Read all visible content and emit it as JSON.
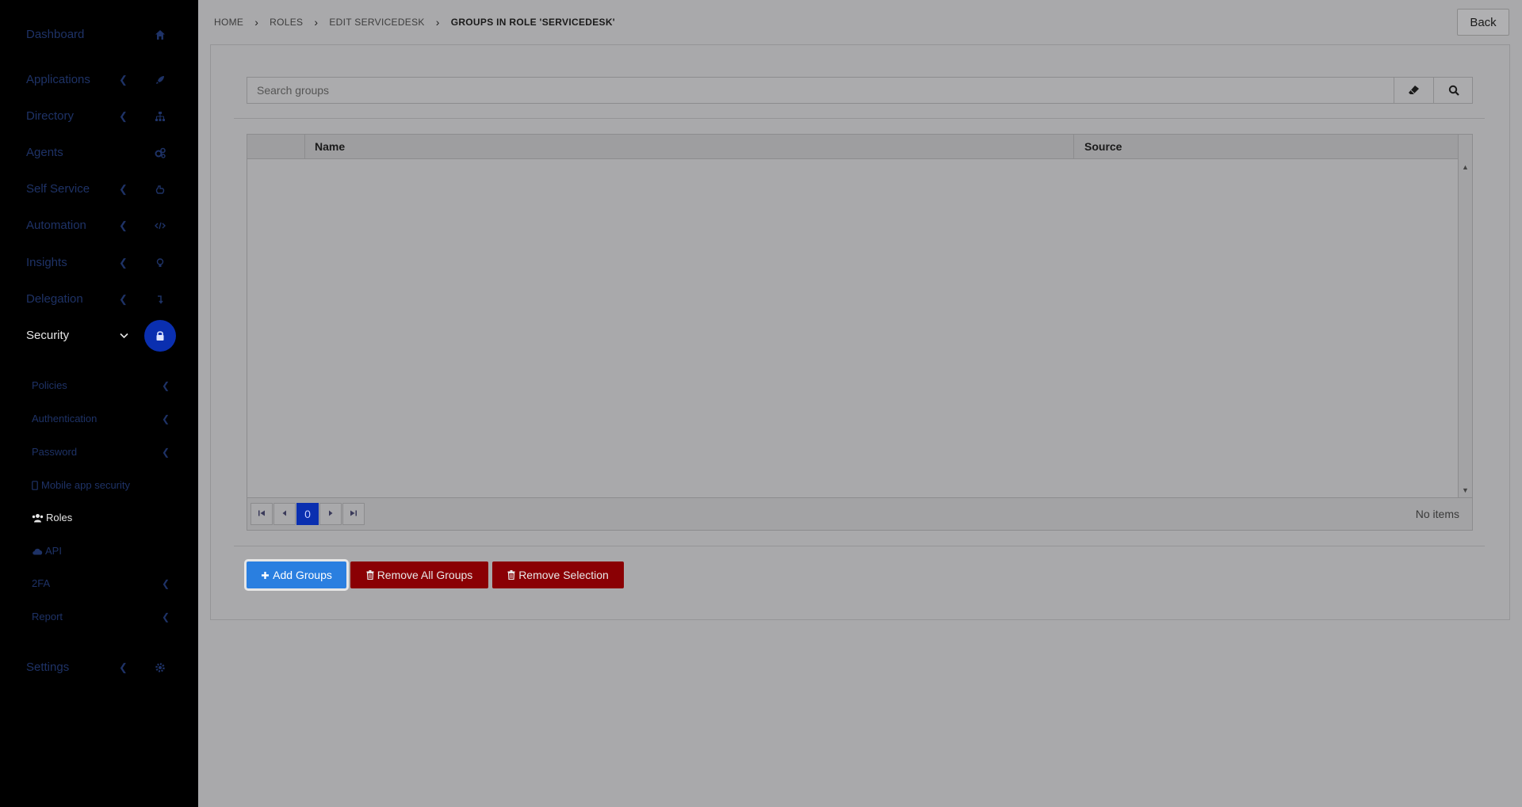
{
  "sidebar": {
    "items": [
      {
        "label": "Dashboard",
        "icon": "home-icon",
        "chevron": false
      },
      {
        "label": "Applications",
        "icon": "rocket-icon",
        "chevron": true
      },
      {
        "label": "Directory",
        "icon": "sitemap-icon",
        "chevron": true
      },
      {
        "label": "Agents",
        "icon": "cogs-icon",
        "chevron": false
      },
      {
        "label": "Self Service",
        "icon": "hand-icon",
        "chevron": true
      },
      {
        "label": "Automation",
        "icon": "code-icon",
        "chevron": true
      },
      {
        "label": "Insights",
        "icon": "lightbulb-icon",
        "chevron": true
      },
      {
        "label": "Delegation",
        "icon": "level-down-icon",
        "chevron": true
      },
      {
        "label": "Security",
        "icon": "lock-icon",
        "chevron": true
      }
    ],
    "security_sub": [
      {
        "label": "Policies",
        "chevron": true
      },
      {
        "label": "Authentication",
        "chevron": true
      },
      {
        "label": "Password",
        "chevron": true
      },
      {
        "label": "Mobile app security",
        "chevron": false
      },
      {
        "label": "Roles",
        "chevron": false
      },
      {
        "label": "API",
        "chevron": false
      },
      {
        "label": "2FA",
        "chevron": true
      },
      {
        "label": "Report",
        "chevron": true
      }
    ],
    "settings": {
      "label": "Settings",
      "icon": "gear-icon"
    }
  },
  "breadcrumb": [
    "HOME",
    "ROLES",
    "EDIT SERVICEDESK",
    "GROUPS IN ROLE 'SERVICEDESK'"
  ],
  "back_label": "Back",
  "search": {
    "placeholder": "Search groups"
  },
  "grid": {
    "columns": [
      "Name",
      "Source"
    ],
    "page": "0",
    "status": "No items"
  },
  "actions": {
    "add": "Add Groups",
    "remove_all": "Remove All Groups",
    "remove_selection": "Remove Selection"
  },
  "colors": {
    "primary": "#2a7fe0",
    "danger": "#8a0004",
    "active_nav": "#0a2fb0"
  }
}
